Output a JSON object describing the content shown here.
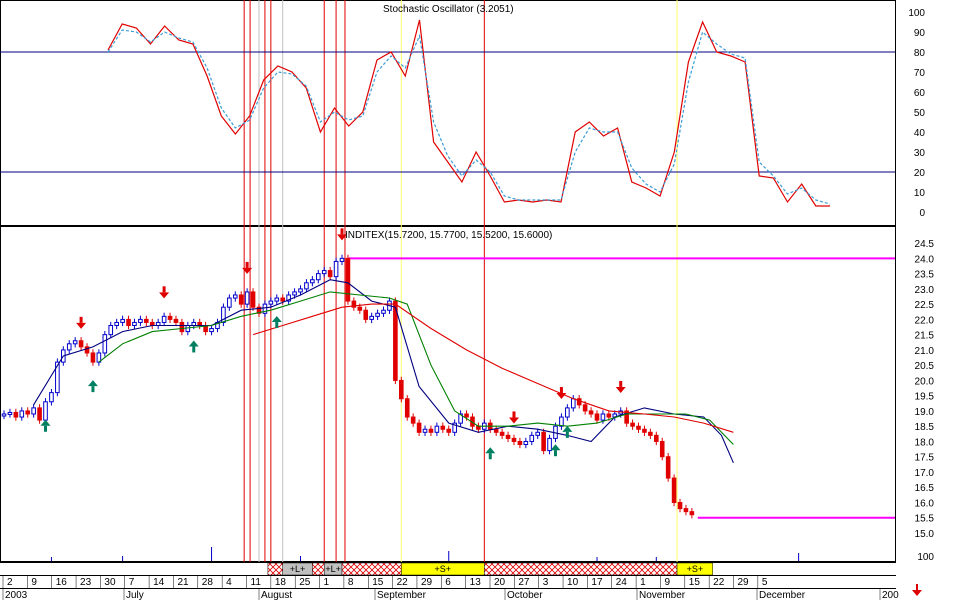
{
  "chart_data": [
    {
      "type": "line",
      "title": "Stochastic Oscillator (3.2051)",
      "ylim": [
        -10,
        110
      ],
      "yticks": [
        0,
        10,
        20,
        30,
        40,
        50,
        60,
        70,
        80,
        90,
        100
      ],
      "hlines": [
        80,
        20
      ],
      "series": [
        {
          "key": "k",
          "color": "#e00000",
          "style": "solid",
          "points": [
            [
              0,
              81
            ],
            [
              1,
              94
            ],
            [
              2,
              92
            ],
            [
              3,
              84
            ],
            [
              4,
              93
            ],
            [
              5,
              86
            ],
            [
              6,
              84
            ],
            [
              7,
              68
            ],
            [
              8,
              48
            ],
            [
              9,
              39
            ],
            [
              10,
              48
            ],
            [
              11,
              66
            ],
            [
              12,
              73
            ],
            [
              13,
              70
            ],
            [
              14,
              62
            ],
            [
              15,
              40
            ],
            [
              16,
              52
            ],
            [
              17,
              43
            ],
            [
              18,
              50
            ],
            [
              19,
              76
            ],
            [
              20,
              80
            ],
            [
              21,
              68
            ],
            [
              22,
              96
            ],
            [
              23,
              35
            ],
            [
              24,
              25
            ],
            [
              25,
              15
            ],
            [
              26,
              30
            ],
            [
              27,
              18
            ],
            [
              28,
              5
            ],
            [
              29,
              6
            ],
            [
              30,
              5
            ],
            [
              31,
              6
            ],
            [
              32,
              5
            ],
            [
              33,
              40
            ],
            [
              34,
              45
            ],
            [
              35,
              38
            ],
            [
              36,
              42
            ],
            [
              37,
              15
            ],
            [
              38,
              12
            ],
            [
              39,
              8
            ],
            [
              40,
              30
            ],
            [
              41,
              75
            ],
            [
              42,
              95
            ],
            [
              43,
              80
            ],
            [
              44,
              78
            ],
            [
              45,
              75
            ],
            [
              46,
              18
            ],
            [
              47,
              17
            ],
            [
              48,
              5
            ],
            [
              49,
              14
            ],
            [
              50,
              3
            ],
            [
              51,
              3
            ]
          ]
        },
        {
          "key": "d",
          "color": "#3a9dd8",
          "style": "dashed",
          "points": [
            [
              0,
              80
            ],
            [
              1,
              91
            ],
            [
              2,
              90
            ],
            [
              3,
              85
            ],
            [
              4,
              90
            ],
            [
              5,
              87
            ],
            [
              6,
              85
            ],
            [
              7,
              72
            ],
            [
              8,
              52
            ],
            [
              9,
              42
            ],
            [
              10,
              46
            ],
            [
              11,
              62
            ],
            [
              12,
              70
            ],
            [
              13,
              69
            ],
            [
              14,
              63
            ],
            [
              15,
              45
            ],
            [
              16,
              50
            ],
            [
              17,
              46
            ],
            [
              18,
              48
            ],
            [
              19,
              70
            ],
            [
              20,
              78
            ],
            [
              21,
              72
            ],
            [
              22,
              88
            ],
            [
              23,
              45
            ],
            [
              24,
              28
            ],
            [
              25,
              18
            ],
            [
              26,
              26
            ],
            [
              27,
              20
            ],
            [
              28,
              8
            ],
            [
              29,
              6
            ],
            [
              30,
              6
            ],
            [
              31,
              6
            ],
            [
              32,
              6
            ],
            [
              33,
              30
            ],
            [
              34,
              42
            ],
            [
              35,
              40
            ],
            [
              36,
              40
            ],
            [
              37,
              22
            ],
            [
              38,
              14
            ],
            [
              39,
              10
            ],
            [
              40,
              24
            ],
            [
              41,
              65
            ],
            [
              42,
              90
            ],
            [
              43,
              84
            ],
            [
              44,
              79
            ],
            [
              45,
              77
            ],
            [
              46,
              25
            ],
            [
              47,
              18
            ],
            [
              48,
              9
            ],
            [
              49,
              12
            ],
            [
              50,
              6
            ],
            [
              51,
              4
            ]
          ]
        }
      ]
    },
    {
      "type": "candlestick",
      "title": "INDITEX(15.7200, 15.7700, 15.5200, 15.6000)",
      "ylim": [
        15.0,
        24.7
      ],
      "yticks": [
        "24.5",
        "24.0",
        "23.5",
        "23.0",
        "22.5",
        "22.0",
        "21.5",
        "21.0",
        "20.5",
        "20.0",
        "19.5",
        "19.0",
        "18.5",
        "18.0",
        "17.5",
        "17.0",
        "16.5",
        "16.0",
        "15.5",
        "15.0"
      ],
      "xlim": [
        0,
        128
      ],
      "x_labels": [
        "2",
        "9",
        "16",
        "23",
        "30",
        "7",
        "14",
        "21",
        "28",
        "4",
        "11",
        "18",
        "25",
        "1",
        "8",
        "15",
        "22",
        "29",
        "6",
        "13",
        "20",
        "27",
        "3",
        "10",
        "17",
        "24",
        "1",
        "9",
        "15",
        "22",
        "29",
        "5"
      ],
      "x_label_pos": [
        0,
        5,
        10,
        15,
        20,
        25,
        30,
        35,
        40,
        45,
        50,
        55,
        60,
        65,
        70,
        75,
        80,
        85,
        90,
        95,
        100,
        105,
        110,
        115,
        120,
        125,
        130,
        135,
        140,
        145,
        150,
        155
      ],
      "months": [
        "2003",
        "July",
        "August",
        "September",
        "October",
        "November",
        "December",
        "200"
      ],
      "month_pos": [
        0,
        20,
        42,
        62,
        84,
        106,
        126,
        147
      ],
      "closes": [
        18.9,
        18.95,
        18.8,
        19.0,
        18.9,
        19.1,
        18.7,
        19.3,
        19.6,
        20.6,
        21.0,
        21.2,
        21.3,
        21.1,
        20.9,
        20.6,
        20.9,
        21.5,
        21.8,
        21.9,
        22.0,
        21.8,
        21.9,
        22.0,
        21.9,
        21.8,
        21.9,
        22.1,
        22.0,
        21.9,
        21.6,
        21.8,
        21.9,
        21.8,
        21.6,
        21.7,
        21.9,
        22.4,
        22.7,
        22.8,
        22.5,
        22.9,
        22.4,
        22.2,
        22.5,
        22.6,
        22.7,
        22.6,
        22.8,
        22.9,
        23.0,
        23.2,
        23.3,
        23.5,
        23.6,
        23.4,
        23.9,
        24.0,
        22.6,
        22.4,
        22.3,
        22.0,
        22.1,
        22.2,
        22.3,
        22.6,
        20.0,
        19.4,
        18.8,
        18.6,
        18.3,
        18.4,
        18.3,
        18.5,
        18.4,
        18.3,
        18.6,
        18.9,
        18.8,
        18.5,
        18.4,
        18.6,
        18.4,
        18.3,
        18.2,
        18.1,
        18.0,
        17.9,
        18.0,
        18.2,
        18.3,
        17.7,
        18.1,
        18.5,
        18.8,
        19.1,
        19.4,
        19.2,
        19.0,
        18.9,
        18.7,
        18.9,
        18.8,
        18.9,
        19.0,
        18.6,
        18.5,
        18.4,
        18.3,
        18.2,
        18.0,
        17.5,
        16.8,
        16.0,
        15.8,
        15.7,
        15.6
      ],
      "series": [
        {
          "key": "ma-fast",
          "color": "#000080",
          "points": [
            [
              5,
              19.2
            ],
            [
              10,
              20.8
            ],
            [
              15,
              21.1
            ],
            [
              20,
              21.6
            ],
            [
              25,
              21.8
            ],
            [
              30,
              21.8
            ],
            [
              35,
              21.8
            ],
            [
              40,
              22.3
            ],
            [
              45,
              22.4
            ],
            [
              50,
              22.8
            ],
            [
              55,
              23.3
            ],
            [
              58,
              23.2
            ],
            [
              62,
              22.6
            ],
            [
              66,
              22.4
            ],
            [
              70,
              19.8
            ],
            [
              75,
              18.6
            ],
            [
              80,
              18.3
            ],
            [
              85,
              18.5
            ],
            [
              90,
              18.4
            ],
            [
              95,
              18.2
            ],
            [
              99,
              18.0
            ],
            [
              103,
              18.8
            ],
            [
              108,
              19.1
            ],
            [
              113,
              18.9
            ],
            [
              118,
              18.8
            ],
            [
              121,
              18.2
            ],
            [
              123,
              17.3
            ]
          ]
        },
        {
          "key": "ma-mid",
          "color": "#008000",
          "points": [
            [
              16,
              20.6
            ],
            [
              20,
              21.2
            ],
            [
              25,
              21.6
            ],
            [
              30,
              21.7
            ],
            [
              35,
              21.8
            ],
            [
              40,
              22.1
            ],
            [
              45,
              22.3
            ],
            [
              50,
              22.6
            ],
            [
              55,
              22.9
            ],
            [
              60,
              22.8
            ],
            [
              65,
              22.7
            ],
            [
              68,
              22.5
            ],
            [
              72,
              20.5
            ],
            [
              76,
              19.0
            ],
            [
              80,
              18.5
            ],
            [
              85,
              18.5
            ],
            [
              90,
              18.6
            ],
            [
              95,
              18.5
            ],
            [
              100,
              18.6
            ],
            [
              105,
              18.9
            ],
            [
              110,
              18.9
            ],
            [
              115,
              18.9
            ],
            [
              119,
              18.7
            ],
            [
              123,
              17.9
            ]
          ]
        },
        {
          "key": "ma-slow",
          "color": "#e00000",
          "points": [
            [
              42,
              21.5
            ],
            [
              47,
              21.8
            ],
            [
              52,
              22.1
            ],
            [
              57,
              22.4
            ],
            [
              62,
              22.5
            ],
            [
              66,
              22.5
            ],
            [
              72,
              21.7
            ],
            [
              78,
              21.0
            ],
            [
              84,
              20.4
            ],
            [
              90,
              19.9
            ],
            [
              96,
              19.4
            ],
            [
              102,
              19.0
            ],
            [
              108,
              18.9
            ],
            [
              113,
              18.8
            ],
            [
              118,
              18.6
            ],
            [
              123,
              18.3
            ]
          ]
        }
      ],
      "hlines": [
        {
          "value": 24.0,
          "from": 58,
          "to": 160,
          "color": "#ff00ff"
        },
        {
          "value": 15.5,
          "from": 117,
          "to": 160,
          "color": "#ff00ff"
        }
      ],
      "buy_arrows": [
        7,
        15,
        32,
        46,
        82,
        93,
        95
      ],
      "sell_arrows": [
        13,
        27,
        41,
        57,
        86,
        94,
        104
      ],
      "red_vlines": [
        40.5,
        41.5,
        44,
        45,
        54,
        56,
        57.5,
        81
      ],
      "yellow_vlines": [
        67,
        113.5
      ],
      "grey_vlines": [
        43,
        47
      ],
      "band_labels": {
        "long1": "+L+",
        "long2": "+L+",
        "short1": "+S+",
        "short2": "+S+"
      }
    }
  ],
  "bottom_axis": {
    "volume_tick": "100"
  }
}
